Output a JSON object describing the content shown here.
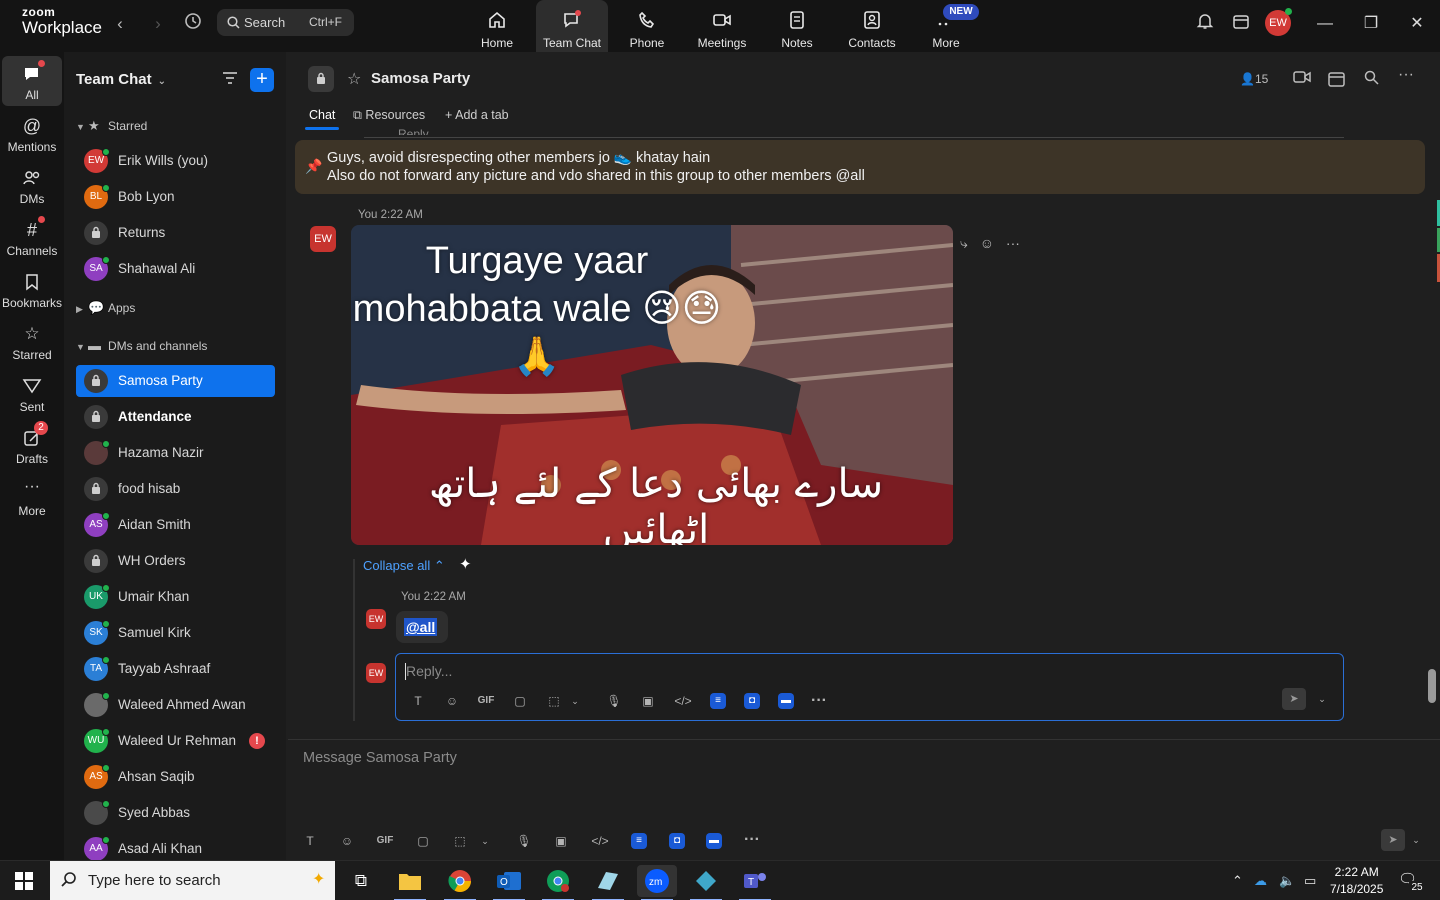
{
  "app": {
    "logo_top": "zoom",
    "logo_bottom": "Workplace"
  },
  "topbar": {
    "search_label": "Search",
    "search_shortcut": "Ctrl+F",
    "nav": [
      {
        "label": "Home",
        "icon": "home-icon"
      },
      {
        "label": "Team Chat",
        "icon": "chat-icon"
      },
      {
        "label": "Phone",
        "icon": "phone-icon"
      },
      {
        "label": "Meetings",
        "icon": "video-icon"
      },
      {
        "label": "Notes",
        "icon": "notes-icon"
      },
      {
        "label": "Contacts",
        "icon": "contacts-icon"
      },
      {
        "label": "More",
        "icon": "more-icon"
      }
    ],
    "new_badge": "NEW",
    "avatar_initials": "EW"
  },
  "rail": [
    {
      "label": "All",
      "icon": "chat-bubble-icon"
    },
    {
      "label": "Mentions",
      "icon": "at-icon"
    },
    {
      "label": "DMs",
      "icon": "people-icon"
    },
    {
      "label": "Channels",
      "icon": "hash-icon"
    },
    {
      "label": "Bookmarks",
      "icon": "bookmark-icon"
    },
    {
      "label": "Starred",
      "icon": "star-icon"
    },
    {
      "label": "Sent",
      "icon": "send-icon"
    },
    {
      "label": "Drafts",
      "icon": "drafts-icon",
      "badge": "2"
    },
    {
      "label": "More",
      "icon": "ellipsis-icon"
    }
  ],
  "sidebar": {
    "title": "Team Chat",
    "sections": {
      "starred": "Starred",
      "apps": "Apps",
      "dms_channels": "DMs and channels"
    },
    "starred": [
      {
        "name": "Erik Wills (you)",
        "initials": "EW",
        "color": "#d23a36"
      },
      {
        "name": "Bob Lyon",
        "initials": "BL",
        "color": "#e06a10"
      },
      {
        "name": "Returns",
        "initials": "",
        "color": "#3a3a3a"
      },
      {
        "name": "Shahawal Ali",
        "initials": "SA",
        "color": "#8f3fc0"
      }
    ],
    "channels": [
      {
        "name": "Samosa Party",
        "initials": "",
        "color": "#3a3a3a"
      },
      {
        "name": "Attendance",
        "initials": "",
        "color": "#3a3a3a"
      },
      {
        "name": "Hazama Nazir",
        "initials": "",
        "color": "#5a3a3a"
      },
      {
        "name": "food hisab",
        "initials": "",
        "color": "#3a3a3a"
      },
      {
        "name": "Aidan Smith",
        "initials": "AS",
        "color": "#8f3fc0"
      },
      {
        "name": "WH Orders",
        "initials": "",
        "color": "#3a3a3a"
      },
      {
        "name": "Umair Khan",
        "initials": "UK",
        "color": "#1a9a6a"
      },
      {
        "name": "Samuel Kirk",
        "initials": "SK",
        "color": "#2b7fd6"
      },
      {
        "name": "Tayyab Ashraaf",
        "initials": "TA",
        "color": "#2b7fd6"
      },
      {
        "name": "Waleed Ahmed Awan",
        "initials": "",
        "color": "#6a6a6a"
      },
      {
        "name": "Waleed Ur Rehman",
        "initials": "WU",
        "color": "#21b24c",
        "alert": "!"
      },
      {
        "name": "Ahsan Saqib",
        "initials": "AS",
        "color": "#e06a10"
      },
      {
        "name": "Syed Abbas",
        "initials": "",
        "color": "#4a4a4a"
      },
      {
        "name": "Asad Ali Khan",
        "initials": "AA",
        "color": "#8f3fc0"
      }
    ]
  },
  "channel": {
    "name": "Samosa Party",
    "member_count": "15",
    "tabs": [
      "Chat",
      "Resources",
      "Add a tab"
    ],
    "peek_text": "Reply",
    "pinned_line1": "Guys, avoid disrespecting other members jo 👟 khatay hain",
    "pinned_line2": "Also do not forward any picture and vdo shared in this group to other members @all"
  },
  "messages": {
    "first_meta": "You 2:22 AM",
    "sender_initials": "EW",
    "image_caption_en": "Turgaye yaar mohabbata wale 😢😓🙏",
    "image_caption_ur": "سارے بھائی دعا کے لئے ہاتھ اٹھائیں",
    "collapse_label": "Collapse all",
    "reply_meta": "You 2:22 AM",
    "reply_text": "@all",
    "reply_placeholder": "Reply...",
    "composer_placeholder": "Message Samosa Party"
  },
  "taskbar": {
    "search_placeholder": "Type here to search",
    "time": "2:22 AM",
    "date": "7/18/2025",
    "notification_count": "25"
  }
}
